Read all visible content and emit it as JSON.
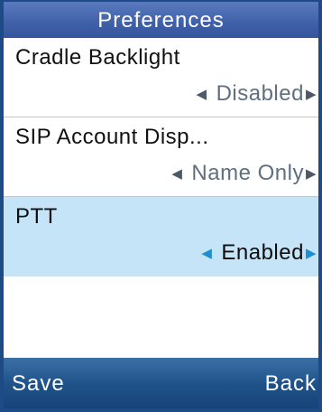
{
  "screen": {
    "title": "Preferences"
  },
  "items": [
    {
      "label": "Cradle Backlight",
      "value": "Disabled"
    },
    {
      "label": "SIP Account Disp...",
      "value": "Name Only"
    },
    {
      "label": "PTT",
      "value": "Enabled",
      "selected": true
    }
  ],
  "softkeys": {
    "left": "Save",
    "right": "Back"
  },
  "colors": {
    "title_bar": "#4565ab",
    "softkey_bar": "#1f5189",
    "selection": "#c6e4f7",
    "selected_arrow": "#1e8fd0"
  },
  "icons": {
    "left_arrow": "triangle-left-icon",
    "right_arrow": "triangle-right-icon"
  }
}
